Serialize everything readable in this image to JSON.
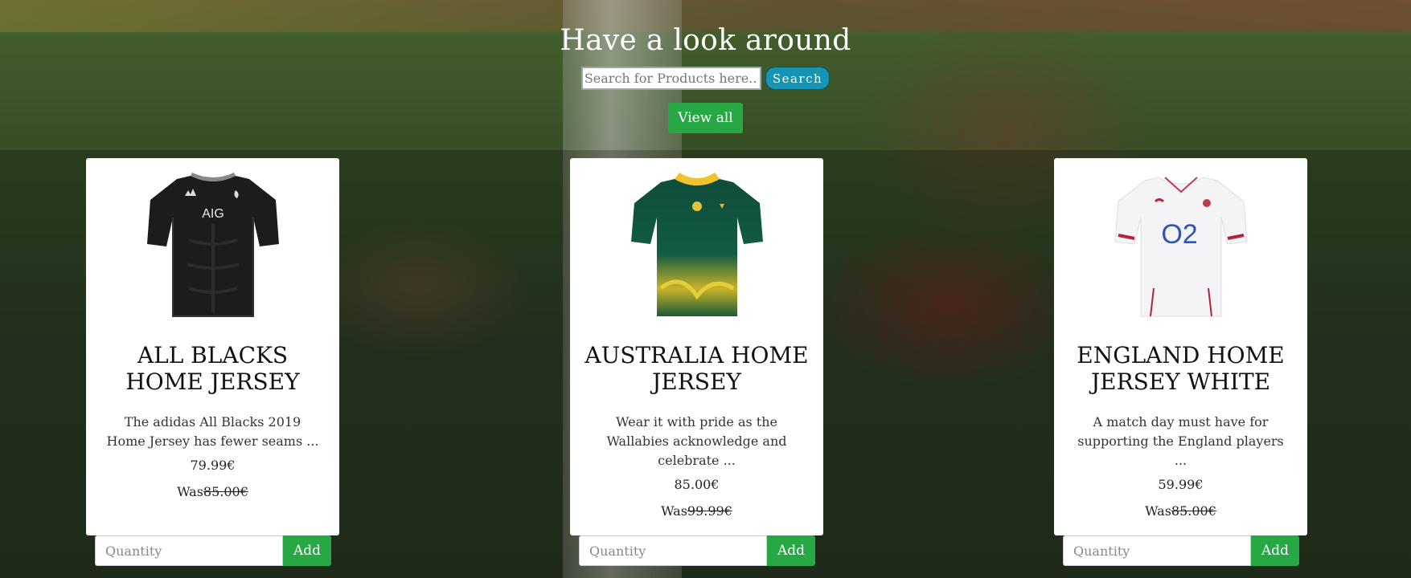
{
  "hero": {
    "title": "Have a look around",
    "search_placeholder": "Search for Products here..",
    "search_label": "Search",
    "view_all_label": "View all"
  },
  "colors": {
    "search_button": "#1595b3",
    "add_button": "#28a745",
    "view_all_button": "#28a745"
  },
  "products": [
    {
      "title": "ALL BLACKS HOME JERSEY",
      "description": "The adidas All Blacks 2019 Home Jersey has fewer seams ...",
      "price": "79.99€",
      "was_label": "Was",
      "was_price": "85.00€",
      "quantity_placeholder": "Quantity",
      "add_label": "Add",
      "sponsor": "AIG"
    },
    {
      "title": "AUSTRALIA HOME JERSEY",
      "description": "Wear it with pride as the Wallabies acknowledge and celebrate ...",
      "price": "85.00€",
      "was_label": "Was",
      "was_price": "99.99€",
      "quantity_placeholder": "Quantity",
      "add_label": "Add"
    },
    {
      "title": "ENGLAND HOME JERSEY WHITE",
      "description": "A match day must have for supporting the England players ...",
      "price": "59.99€",
      "was_label": "Was",
      "was_price": "85.00€",
      "quantity_placeholder": "Quantity",
      "add_label": "Add",
      "sponsor": "O2"
    }
  ]
}
